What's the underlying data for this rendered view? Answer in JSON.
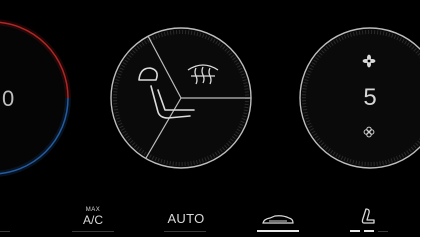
{
  "temperature": {
    "value": "0"
  },
  "fan": {
    "speed": "5",
    "icons": [
      "fan-icon",
      "fan-small-icon"
    ]
  },
  "seat_dial": {
    "icons": [
      "defrost-icon",
      "seat-icon"
    ]
  },
  "buttons": {
    "max_ac_top": "MAX",
    "max_ac": "A/C",
    "auto": "AUTO",
    "recirc_icon": "car-recirculation-icon",
    "seat_heat_icon": "seat-heat-icon"
  },
  "colors": {
    "hot": "#e4302f",
    "cold": "#2e73c8",
    "ring": "#bdbdbd",
    "active": "#e6e6e6"
  }
}
